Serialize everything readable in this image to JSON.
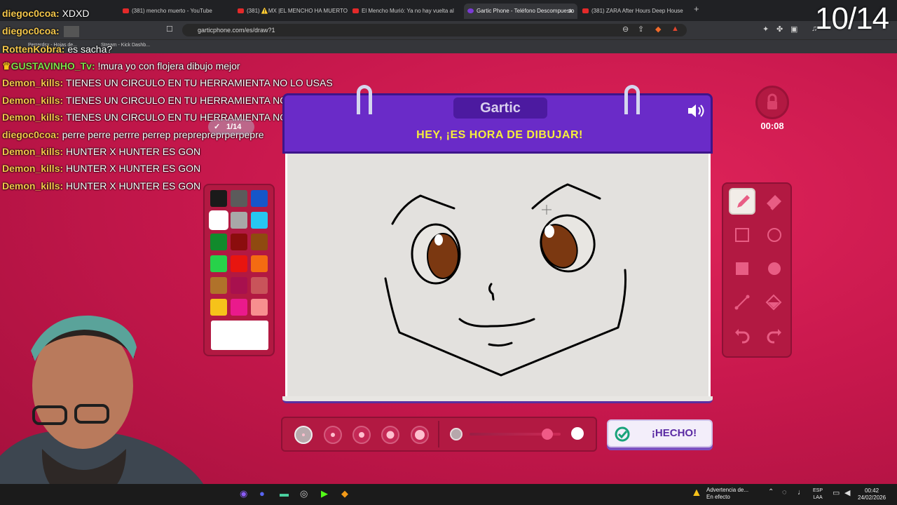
{
  "browser": {
    "tabs": [
      {
        "label": "(381) mencho muerto - YouTube"
      },
      {
        "label": "(381) ⚠️MX |EL MENCHO HA MUERTO"
      },
      {
        "label": "El Mencho Murió: Ya no hay vuelta al"
      },
      {
        "label": "Gartic Phone - Teléfono Descompuesto",
        "active": true
      },
      {
        "label": "(381) ZARA After Hours Deep House"
      }
    ],
    "url": "garticphone.com/es/draw?1",
    "bookmarks": [
      "Perrerdsx - Hojas de...",
      "Stream - Kick Dashb..."
    ]
  },
  "chat": [
    {
      "user": "diegoc0coa:",
      "message": "XDXD"
    },
    {
      "user": "diegoc0coa:",
      "message": ""
    },
    {
      "user": "RottenKobra:",
      "message": "es sacha?"
    },
    {
      "user": "GUSTAVINHO_Tv:",
      "message": "!mura yo con flojera dibujo mejor"
    },
    {
      "user": "Demon_kills:",
      "message": "TIENES UN CIRCULO EN TU HERRAMIENTA NO LO USAS"
    },
    {
      "user": "Demon_kills:",
      "message": "TIENES UN CIRCULO EN TU HERRAMIENTA NO LO USAS"
    },
    {
      "user": "Demon_kills:",
      "message": "TIENES UN CIRCULO EN TU HERRAMIENTA NO LO USAS"
    },
    {
      "user": "diegoc0coa:",
      "message": "perre perre perrre perrep preprepreprperpepre"
    },
    {
      "user": "Demon_kills:",
      "message": "HUNTER X HUNTER ES GON"
    },
    {
      "user": "Demon_kills:",
      "message": "HUNTER X HUNTER ES GON"
    },
    {
      "user": "Demon_kills:",
      "message": "HUNTER X HUNTER ES GON"
    }
  ],
  "overlay_counter": "10/14",
  "game": {
    "logo": "Gartic",
    "heading": "HEY, ¡ES HORA DE DIBUJAR!",
    "timer": "00:08",
    "round_badge": "1/14",
    "done_label": "¡HECHO!",
    "palette": [
      "#1a1a1a",
      "#5b5b5b",
      "#1556c9",
      "#ffffff",
      "#a8a8a8",
      "#27c6f1",
      "#118a2c",
      "#8b0d0d",
      "#8f4a10",
      "#27d24a",
      "#e8150f",
      "#f46b12",
      "#b0722a",
      "#a8104e",
      "#c9545a",
      "#f6c21a",
      "#ea1a8c",
      "#f78f8f"
    ],
    "selected_color_index": 3,
    "custom_color": "#ffffff",
    "tools": [
      "pencil-tool",
      "eraser-tool",
      "rectangle-outline-tool",
      "circle-outline-tool",
      "rectangle-filled-tool",
      "circle-filled-tool",
      "line-tool",
      "fill-bucket-tool",
      "undo-tool",
      "redo-tool"
    ],
    "selected_tool": "pencil-tool",
    "brush_sizes": 5,
    "selected_brush_size": 1,
    "opacity_level": 0.85
  },
  "taskbar": {
    "warning_title": "Advertencia de...",
    "warning_sub": "En efecto",
    "lang_top": "ESP",
    "lang_bottom": "LAA",
    "time": "00:42",
    "date": "24/02/2026"
  }
}
